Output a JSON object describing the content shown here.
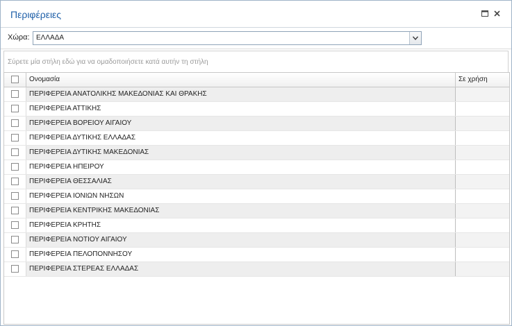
{
  "window": {
    "title": "Περιφέρειες"
  },
  "filter": {
    "label": "Χώρα:",
    "value": "ΕΛΛΑΔΑ"
  },
  "group_panel": {
    "hint": "Σύρετε μία στήλη εδώ για να ομαδοποιήσετε κατά αυτήν τη στήλη"
  },
  "grid": {
    "columns": {
      "name": "Ονομασία",
      "in_use": "Σε χρήση"
    },
    "rows": [
      {
        "name": "ΠΕΡΙΦΕΡΕΙΑ ΑΝΑΤΟΛΙΚΗΣ ΜΑΚΕΔΟΝΙΑΣ ΚΑΙ ΘΡΑΚΗΣ",
        "in_use": ""
      },
      {
        "name": "ΠΕΡΙΦΕΡΕΙΑ ΑΤΤΙΚΗΣ",
        "in_use": ""
      },
      {
        "name": "ΠΕΡΙΦΕΡΕΙΑ ΒΟΡΕΙΟΥ ΑΙΓΑΙΟΥ",
        "in_use": ""
      },
      {
        "name": "ΠΕΡΙΦΕΡΕΙΑ ΔΥΤΙΚΗΣ ΕΛΛΑΔΑΣ",
        "in_use": ""
      },
      {
        "name": "ΠΕΡΙΦΕΡΕΙΑ ΔΥΤΙΚΗΣ ΜΑΚΕΔΟΝΙΑΣ",
        "in_use": ""
      },
      {
        "name": "ΠΕΡΙΦΕΡΕΙΑ ΗΠΕΙΡΟΥ",
        "in_use": ""
      },
      {
        "name": "ΠΕΡΙΦΕΡΕΙΑ ΘΕΣΣΑΛΙΑΣ",
        "in_use": ""
      },
      {
        "name": "ΠΕΡΙΦΕΡΕΙΑ ΙΟΝΙΩΝ ΝΗΣΩΝ",
        "in_use": ""
      },
      {
        "name": "ΠΕΡΙΦΕΡΕΙΑ ΚΕΝΤΡΙΚΗΣ ΜΑΚΕΔΟΝΙΑΣ",
        "in_use": ""
      },
      {
        "name": "ΠΕΡΙΦΕΡΕΙΑ ΚΡΗΤΗΣ",
        "in_use": ""
      },
      {
        "name": "ΠΕΡΙΦΕΡΕΙΑ ΝΟΤΙΟΥ ΑΙΓΑΙΟΥ",
        "in_use": ""
      },
      {
        "name": "ΠΕΡΙΦΕΡΕΙΑ ΠΕΛΟΠΟΝΝΗΣΟΥ",
        "in_use": ""
      },
      {
        "name": "ΠΕΡΙΦΕΡΕΙΑ ΣΤΕΡΕΑΣ ΕΛΛΑΔΑΣ",
        "in_use": ""
      }
    ]
  },
  "icons": {
    "maximize": "maximize-icon",
    "close": "close-icon",
    "dropdown": "chevron-down-icon"
  },
  "colors": {
    "title": "#1e5fa8",
    "grid_border": "#c8c8c8",
    "row_alt": "#eeeeee"
  }
}
